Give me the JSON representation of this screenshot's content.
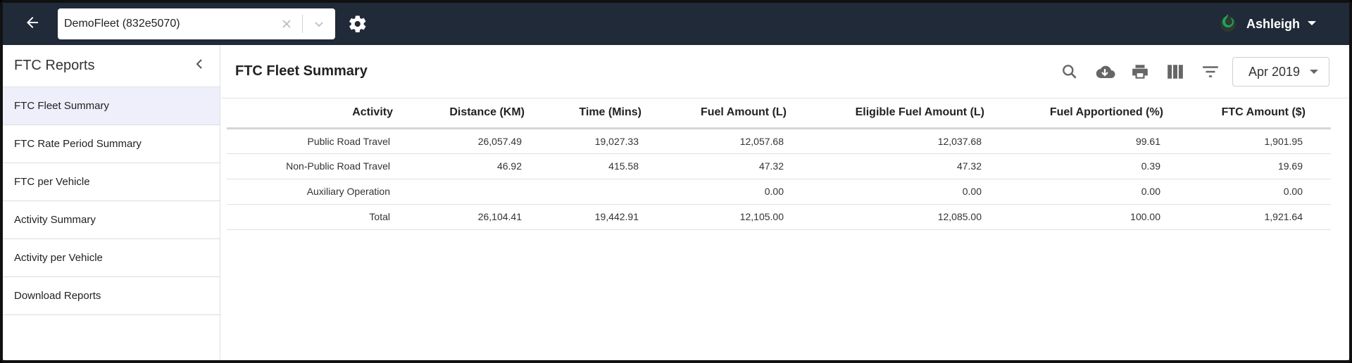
{
  "header": {
    "fleet_select_value": "DemoFleet (832e5070)",
    "user_name": "Ashleigh",
    "icons": [
      "back-arrow-icon",
      "clear-icon",
      "chevron-down-icon",
      "gear-icon",
      "flame-logo-icon",
      "caret-down-icon"
    ]
  },
  "sidebar": {
    "title": "FTC Reports",
    "items": [
      {
        "label": "FTC Fleet Summary",
        "active": true
      },
      {
        "label": "FTC Rate Period Summary",
        "active": false
      },
      {
        "label": "FTC per Vehicle",
        "active": false
      },
      {
        "label": "Activity Summary",
        "active": false
      },
      {
        "label": "Activity per Vehicle",
        "active": false
      },
      {
        "label": "Download Reports",
        "active": false
      }
    ]
  },
  "main": {
    "title": "FTC Fleet Summary",
    "toolbar_icons": [
      "search-icon",
      "cloud-download-icon",
      "print-icon",
      "columns-icon",
      "filter-icon"
    ],
    "month": "Apr 2019",
    "table": {
      "headers": [
        "Activity",
        "Distance (KM)",
        "Time (Mins)",
        "Fuel Amount (L)",
        "Eligible Fuel Amount (L)",
        "Fuel Apportioned (%)",
        "FTC Amount ($)"
      ],
      "rows": [
        [
          "Public Road Travel",
          "26,057.49",
          "19,027.33",
          "12,057.68",
          "12,037.68",
          "99.61",
          "1,901.95"
        ],
        [
          "Non-Public Road Travel",
          "46.92",
          "415.58",
          "47.32",
          "47.32",
          "0.39",
          "19.69"
        ],
        [
          "Auxiliary Operation",
          "",
          "",
          "0.00",
          "0.00",
          "0.00",
          "0.00"
        ],
        [
          "Total",
          "26,104.41",
          "19,442.91",
          "12,105.00",
          "12,085.00",
          "100.00",
          "1,921.64"
        ]
      ]
    }
  },
  "colors": {
    "topbar": "#202a38",
    "active_item": "#eeeffb",
    "logo_green": "#1ea35b"
  }
}
